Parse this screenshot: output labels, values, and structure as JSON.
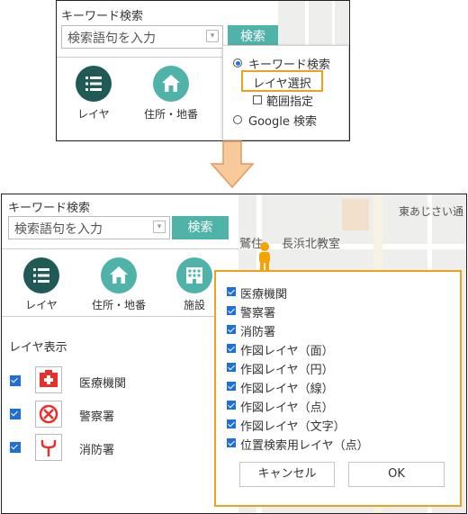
{
  "top": {
    "keyword_title": "キーワード検索",
    "search_placeholder": "検索語句を入力",
    "search_button": "検索",
    "icons": [
      {
        "label": "レイヤ",
        "icon": "list-icon"
      },
      {
        "label": "住所・地番",
        "icon": "home-icon"
      }
    ],
    "dropdown": {
      "options": [
        {
          "label": "キーワード検索",
          "selected": true
        },
        {
          "label": "レイヤ選択",
          "highlighted": true
        },
        {
          "label": "範囲指定",
          "checkbox": true,
          "checked": false
        },
        {
          "label": "Google 検索",
          "selected": false
        }
      ]
    }
  },
  "bottom": {
    "keyword_title": "キーワード検索",
    "search_placeholder": "検索語句を入力",
    "search_button": "検索",
    "icons": [
      {
        "label": "レイヤ",
        "icon": "list-icon"
      },
      {
        "label": "住所・地番",
        "icon": "home-icon"
      },
      {
        "label": "施設",
        "icon": "building-icon"
      }
    ],
    "layer_display_title": "レイヤ表示",
    "layers": [
      {
        "label": "医療機関",
        "checked": true,
        "icon": "hospital-icon"
      },
      {
        "label": "警察署",
        "checked": true,
        "icon": "police-icon"
      },
      {
        "label": "消防署",
        "checked": true,
        "icon": "fire-station-icon"
      }
    ],
    "map_texts": [
      "鷲住",
      "長浜北教室",
      "東あじさい通"
    ],
    "layer_select_popup": {
      "items": [
        {
          "label": "医療機関",
          "checked": true
        },
        {
          "label": "警察署",
          "checked": true
        },
        {
          "label": "消防署",
          "checked": true
        },
        {
          "label": "作図レイヤ（面）",
          "checked": true
        },
        {
          "label": "作図レイヤ（円）",
          "checked": true
        },
        {
          "label": "作図レイヤ（線）",
          "checked": true
        },
        {
          "label": "作図レイヤ（点）",
          "checked": true
        },
        {
          "label": "作図レイヤ（文字）",
          "checked": true
        },
        {
          "label": "位置検索用レイヤ（点）",
          "checked": true
        }
      ],
      "cancel_button": "キャンセル",
      "ok_button": "OK"
    }
  },
  "colors": {
    "accent_teal": "#4fb3a9",
    "icon_dark_teal": "#1f5a57",
    "highlight_orange": "#f0a020",
    "checkbox_blue": "#1f6fd8"
  }
}
